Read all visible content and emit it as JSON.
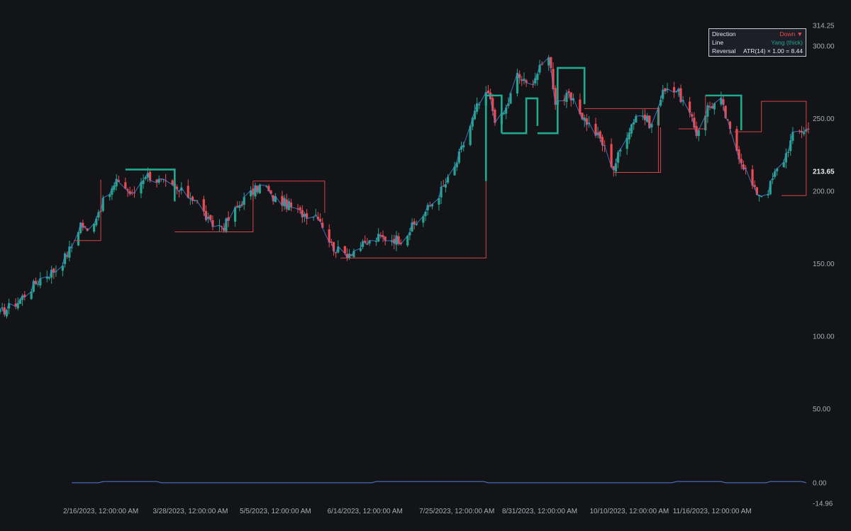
{
  "chart_data": {
    "type": "candlestick",
    "main_pane": {
      "y_axis_ticks": [
        "314.25",
        "300.00",
        "250.00",
        "213.65",
        "200.00",
        "150.00",
        "100.00",
        "50.00"
      ],
      "y_axis_tick_values": [
        314.25,
        300,
        250,
        213.65,
        200,
        150,
        100,
        50
      ],
      "current_value_label": "213.65",
      "ylim": [
        0,
        314.25
      ]
    },
    "indicator_pane": {
      "y_axis_ticks": [
        "0.00",
        "-14.96"
      ],
      "y_axis_tick_values": [
        0,
        -14.96
      ]
    },
    "x_axis_ticks": [
      "2/16/2023, 12:00:00 AM",
      "3/28/2023, 12:00:00 AM",
      "5/5/2023, 12:00:00 AM",
      "6/14/2023, 12:00:00 AM",
      "7/25/2023, 12:00:00 AM",
      "8/31/2023, 12:00:00 AM",
      "10/10/2023, 12:00:00 AM",
      "11/16/2023, 12:00:00 AM"
    ],
    "x_axis_tick_dates": [
      "2023-02-16",
      "2023-03-28",
      "2023-05-05",
      "2023-06-14",
      "2023-07-25",
      "2023-08-31",
      "2023-10-10",
      "2023-11-16"
    ],
    "x_range": [
      "2023-01-02",
      "2023-12-29"
    ],
    "price_anchors": [
      [
        "2023-01-02",
        116
      ],
      [
        "2023-01-10",
        124
      ],
      [
        "2023-01-20",
        140
      ],
      [
        "2023-01-28",
        147
      ],
      [
        "2023-02-03",
        162
      ],
      [
        "2023-02-07",
        178
      ],
      [
        "2023-02-10",
        172
      ],
      [
        "2023-02-17",
        192
      ],
      [
        "2023-02-24",
        208
      ],
      [
        "2023-03-02",
        197
      ],
      [
        "2023-03-08",
        212
      ],
      [
        "2023-03-14",
        207
      ],
      [
        "2023-03-23",
        200
      ],
      [
        "2023-03-30",
        195
      ],
      [
        "2023-04-06",
        177
      ],
      [
        "2023-04-12",
        176
      ],
      [
        "2023-04-20",
        193
      ],
      [
        "2023-04-30",
        206
      ],
      [
        "2023-05-03",
        196
      ],
      [
        "2023-05-09",
        192
      ],
      [
        "2023-05-16",
        185
      ],
      [
        "2023-05-24",
        184
      ],
      [
        "2023-05-30",
        163
      ],
      [
        "2023-06-04",
        156
      ],
      [
        "2023-06-10",
        160
      ],
      [
        "2023-06-20",
        168
      ],
      [
        "2023-06-30",
        167
      ],
      [
        "2023-07-08",
        180
      ],
      [
        "2023-07-16",
        196
      ],
      [
        "2023-07-23",
        212
      ],
      [
        "2023-07-29",
        237
      ],
      [
        "2023-08-03",
        258
      ],
      [
        "2023-08-08",
        267
      ],
      [
        "2023-08-12",
        245
      ],
      [
        "2023-08-16",
        257
      ],
      [
        "2023-08-21",
        280
      ],
      [
        "2023-08-26",
        272
      ],
      [
        "2023-08-31",
        284
      ],
      [
        "2023-09-04",
        295
      ],
      [
        "2023-09-07",
        262
      ],
      [
        "2023-09-13",
        265
      ],
      [
        "2023-09-20",
        250
      ],
      [
        "2023-09-27",
        236
      ],
      [
        "2023-10-03",
        216
      ],
      [
        "2023-10-08",
        237
      ],
      [
        "2023-10-14",
        256
      ],
      [
        "2023-10-20",
        245
      ],
      [
        "2023-10-26",
        272
      ],
      [
        "2023-10-31",
        270
      ],
      [
        "2023-11-05",
        256
      ],
      [
        "2023-11-09",
        240
      ],
      [
        "2023-11-14",
        258
      ],
      [
        "2023-11-20",
        262
      ],
      [
        "2023-11-25",
        236
      ],
      [
        "2023-11-30",
        218
      ],
      [
        "2023-12-05",
        200
      ],
      [
        "2023-12-10",
        197
      ],
      [
        "2023-12-14",
        212
      ],
      [
        "2023-12-18",
        222
      ],
      [
        "2023-12-22",
        238
      ],
      [
        "2023-12-26",
        242
      ],
      [
        "2023-12-29",
        243
      ]
    ],
    "kagi_segments": [
      {
        "kind": "yin",
        "points": [
          [
            "2023-02-04",
            166
          ],
          [
            "2023-02-16",
            166
          ],
          [
            "2023-02-16",
            208
          ]
        ]
      },
      {
        "kind": "yang",
        "points": [
          [
            "2023-02-27",
            215
          ],
          [
            "2023-03-21",
            215
          ],
          [
            "2023-03-21",
            193
          ]
        ]
      },
      {
        "kind": "yin",
        "points": [
          [
            "2023-03-21",
            172
          ],
          [
            "2023-04-25",
            172
          ],
          [
            "2023-04-25",
            207
          ]
        ]
      },
      {
        "kind": "yin",
        "points": [
          [
            "2023-04-25",
            207
          ],
          [
            "2023-05-27",
            207
          ],
          [
            "2023-05-27",
            185
          ]
        ]
      },
      {
        "kind": "yin",
        "points": [
          [
            "2023-06-03",
            154
          ],
          [
            "2023-08-07",
            154
          ],
          [
            "2023-08-07",
            207
          ]
        ]
      },
      {
        "kind": "yang",
        "points": [
          [
            "2023-08-07",
            207
          ],
          [
            "2023-08-07",
            266
          ],
          [
            "2023-08-14",
            266
          ],
          [
            "2023-08-14",
            240
          ]
        ]
      },
      {
        "kind": "yang",
        "points": [
          [
            "2023-08-14",
            240
          ],
          [
            "2023-08-25",
            240
          ],
          [
            "2023-08-25",
            264
          ],
          [
            "2023-08-30",
            264
          ],
          [
            "2023-08-30",
            245
          ]
        ]
      },
      {
        "kind": "yang",
        "points": [
          [
            "2023-08-30",
            240
          ],
          [
            "2023-09-08",
            240
          ],
          [
            "2023-09-08",
            285
          ],
          [
            "2023-09-20",
            285
          ],
          [
            "2023-09-20",
            260
          ]
        ]
      },
      {
        "kind": "yin",
        "points": [
          [
            "2023-09-20",
            257
          ],
          [
            "2023-10-23",
            257
          ],
          [
            "2023-10-23",
            213
          ]
        ]
      },
      {
        "kind": "yin",
        "points": [
          [
            "2023-10-03",
            213
          ],
          [
            "2023-10-24",
            213
          ],
          [
            "2023-10-24",
            244
          ]
        ]
      },
      {
        "kind": "yin",
        "points": [
          [
            "2023-11-01",
            243
          ],
          [
            "2023-11-13",
            243
          ],
          [
            "2023-11-13",
            266
          ]
        ]
      },
      {
        "kind": "yang",
        "points": [
          [
            "2023-11-13",
            266
          ],
          [
            "2023-11-29",
            266
          ],
          [
            "2023-11-29",
            242
          ]
        ]
      },
      {
        "kind": "yin",
        "points": [
          [
            "2023-11-26",
            241
          ],
          [
            "2023-12-08",
            241
          ],
          [
            "2023-12-08",
            262
          ]
        ]
      },
      {
        "kind": "yin",
        "points": [
          [
            "2023-12-08",
            262
          ],
          [
            "2023-12-28",
            262
          ],
          [
            "2023-12-28",
            197
          ]
        ]
      },
      {
        "kind": "yin",
        "points": [
          [
            "2023-12-17",
            197
          ],
          [
            "2023-12-28",
            197
          ]
        ]
      }
    ],
    "legend": [
      {
        "key": "Direction",
        "value": "Down ▼",
        "color": "#f0494f"
      },
      {
        "key": "Line",
        "value": "Yang (thick)",
        "color": "#22a58c"
      },
      {
        "key": "Reversal",
        "value": "ATR(14) × 1.00 = 8.44",
        "color": "#e6e7ea"
      }
    ],
    "colors": {
      "background": "#131417",
      "up_candle": "#22a58c",
      "down_candle": "#f0494f",
      "yang_line": "#1faa8f",
      "yin_line": "#d8424a",
      "close_line": "#4f7ed8",
      "indicator_line": "#4f7ed8",
      "axis_text": "#a9abb3"
    }
  }
}
